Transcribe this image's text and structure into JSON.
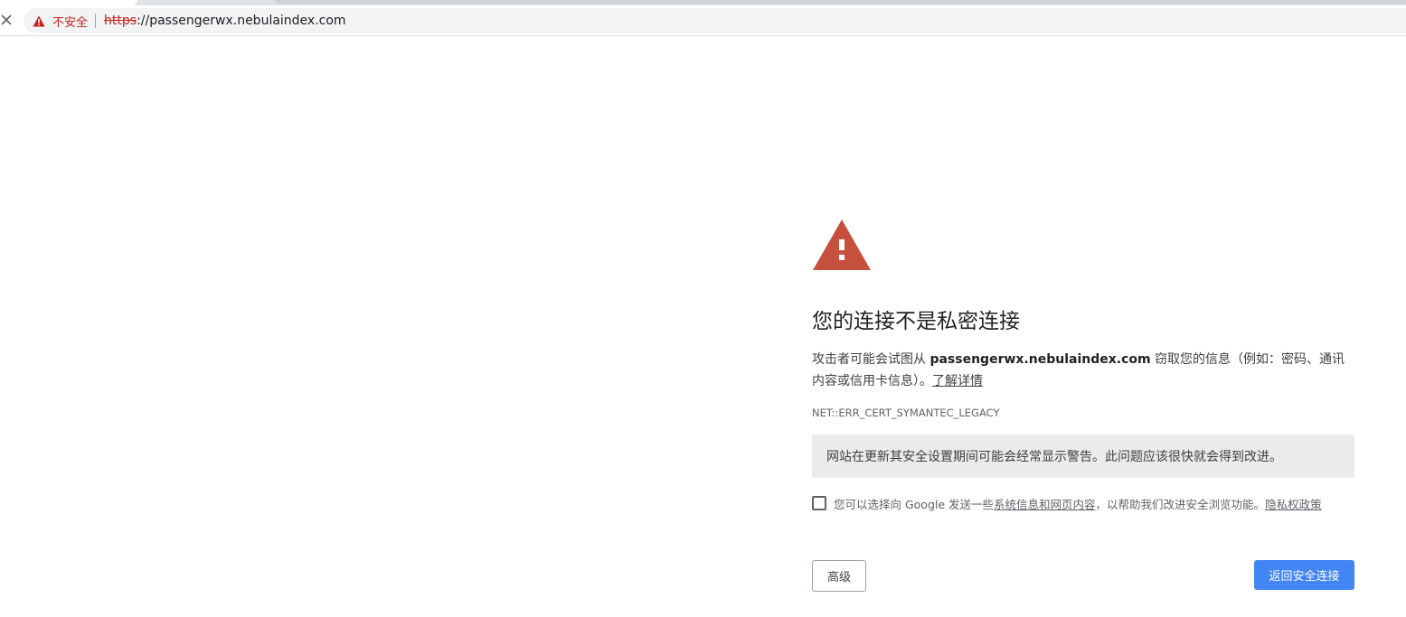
{
  "browser": {
    "security_label": "不安全",
    "url_scheme": "https",
    "url_rest": "://passengerwx.nebulaindex.com"
  },
  "interstitial": {
    "heading": "您的连接不是私密连接",
    "para_prefix": "攻击者可能会试图从 ",
    "para_host": "passengerwx.nebulaindex.com",
    "para_suffix": " 窃取您的信息（例如：密码、通讯内容或信用卡信息）。",
    "learn_more": "了解详情",
    "error_code": "NET::ERR_CERT_SYMANTEC_LEGACY",
    "notice": "网站在更新其安全设置期间可能会经常显示警告。此问题应该很快就会得到改进。",
    "optin_prefix": "您可以选择向 Google 发送一些",
    "optin_link": "系统信息和网页内容",
    "optin_suffix": "，以帮助我们改进安全浏览功能。",
    "privacy_link": "隐私权政策",
    "advanced_button": "高级",
    "back_button": "返回安全连接"
  },
  "colors": {
    "warning_red": "#c5221f",
    "warning_triangle": "#c5503d",
    "primary_blue": "#4285f4",
    "notice_bg": "#ebebeb"
  },
  "icons": {
    "stop": "close-icon",
    "omnibox_warning": "warning-triangle-icon",
    "big_warning": "warning-triangle-icon"
  }
}
